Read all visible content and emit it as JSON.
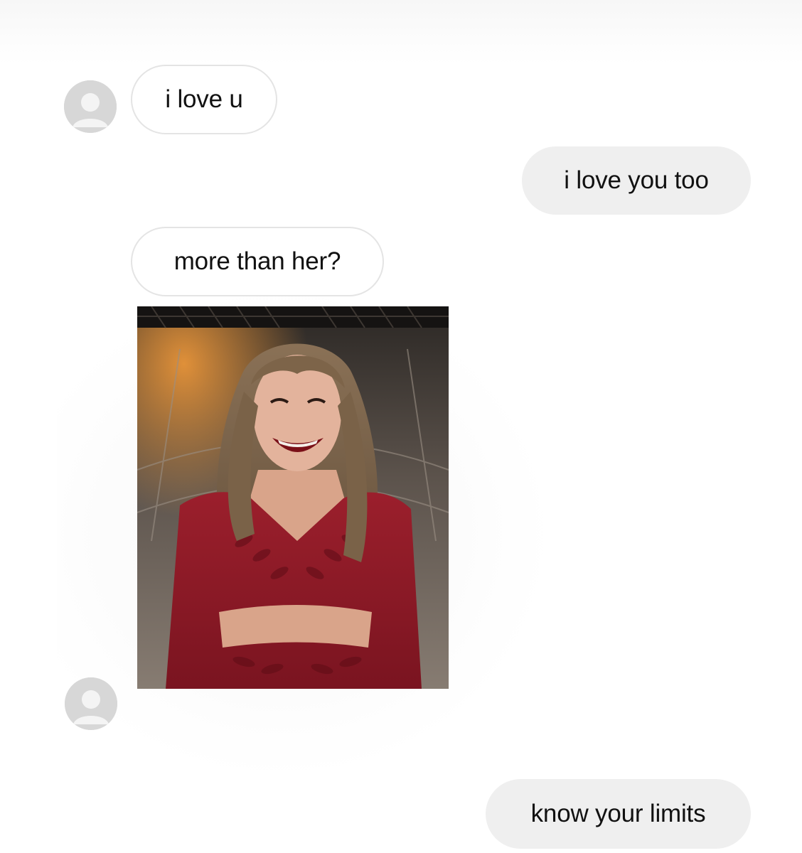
{
  "messages": [
    {
      "from": "them",
      "text": "i love u"
    },
    {
      "from": "me",
      "text": "i love you too"
    },
    {
      "from": "them",
      "text": "more than her?"
    },
    {
      "from": "them",
      "attachment": "photo",
      "icon": "photo-attachment"
    },
    {
      "from": "me",
      "text": "know your limits"
    }
  ],
  "avatars": [
    {
      "icon": "default-user-avatar-icon"
    },
    {
      "icon": "default-user-avatar-icon"
    }
  ],
  "colors": {
    "incoming_bubble_bg": "#ffffff",
    "incoming_bubble_border": "#e4e4e4",
    "outgoing_bubble_bg": "#efefef",
    "text": "#111111",
    "avatar_bg": "#d7d7d7"
  }
}
